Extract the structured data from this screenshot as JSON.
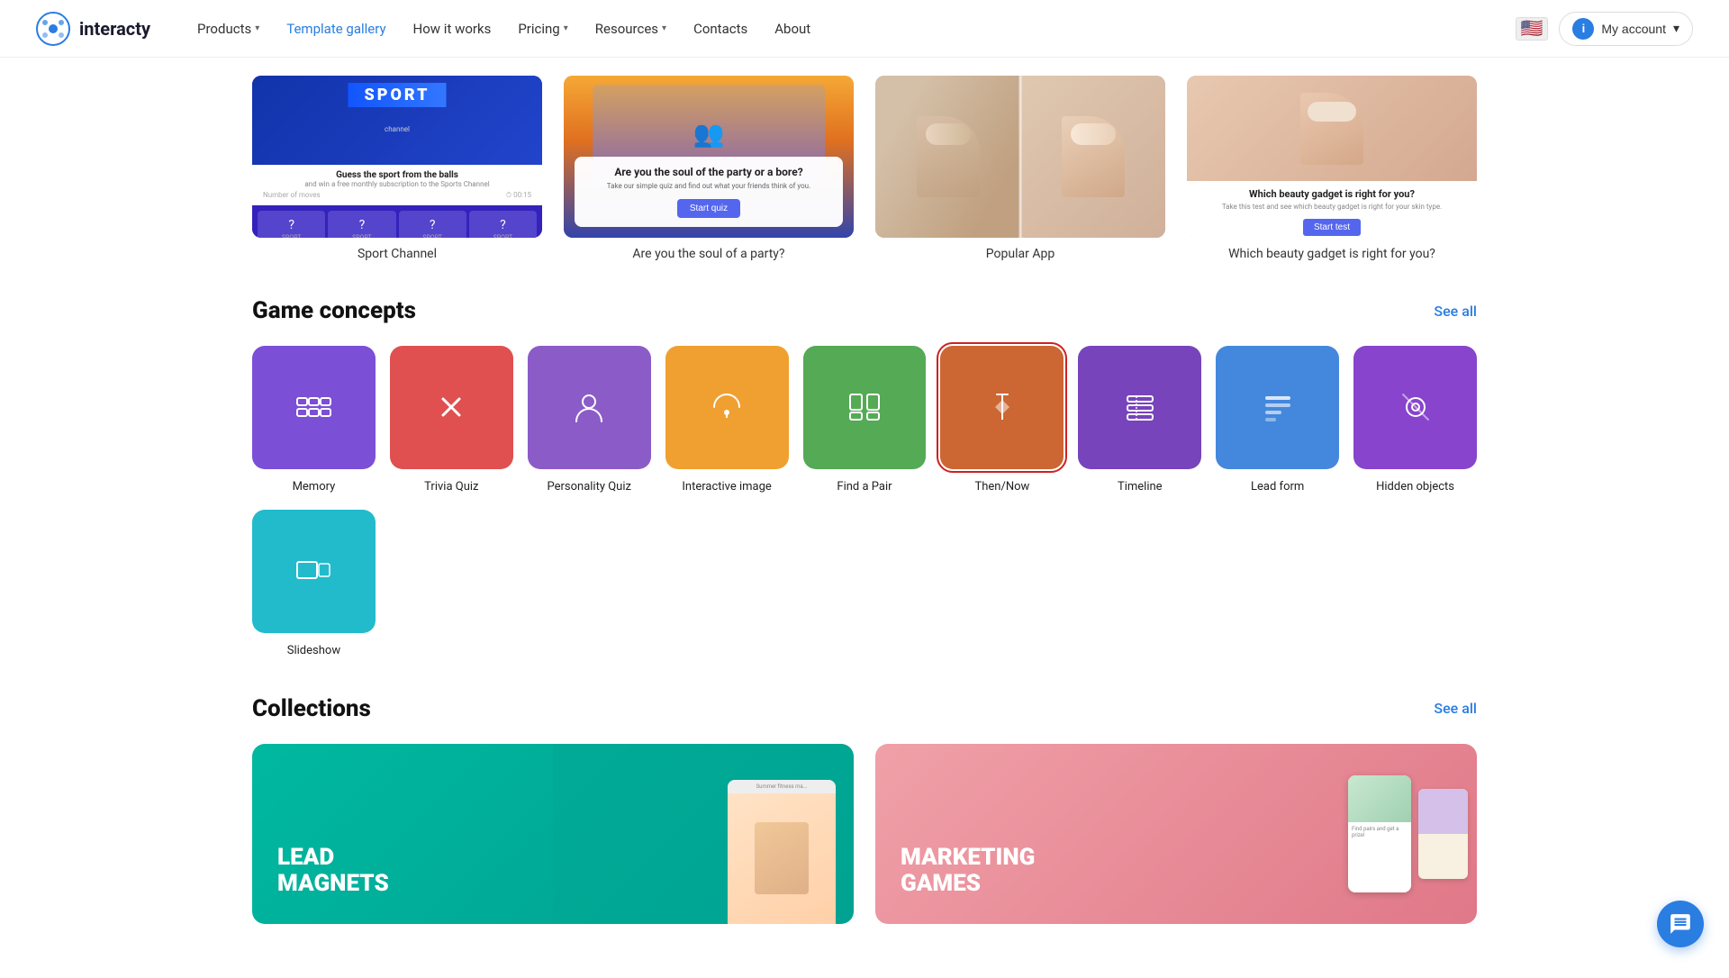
{
  "brand": {
    "name": "interacty"
  },
  "nav": {
    "links": [
      {
        "label": "Products",
        "hasDropdown": true,
        "active": false
      },
      {
        "label": "Template gallery",
        "hasDropdown": false,
        "active": true
      },
      {
        "label": "How it works",
        "hasDropdown": false,
        "active": false
      },
      {
        "label": "Pricing",
        "hasDropdown": true,
        "active": false
      },
      {
        "label": "Resources",
        "hasDropdown": true,
        "active": false
      },
      {
        "label": "Contacts",
        "hasDropdown": false,
        "active": false
      },
      {
        "label": "About",
        "hasDropdown": false,
        "active": false
      }
    ],
    "account_label": "My account",
    "flag": "🇺🇸"
  },
  "featured_templates": [
    {
      "title": "Sport Channel",
      "type": "sport"
    },
    {
      "title": "Are you the soul of a party?",
      "type": "party"
    },
    {
      "title": "Popular App",
      "type": "popular"
    },
    {
      "title": "Which beauty gadget is right for you?",
      "type": "beauty"
    }
  ],
  "game_concepts": {
    "section_title": "Game concepts",
    "see_all": "See all",
    "items": [
      {
        "label": "Memory",
        "color": "#7B4FD6",
        "type": "memory",
        "selected": false
      },
      {
        "label": "Trivia Quiz",
        "color": "#E05050",
        "type": "trivia",
        "selected": false
      },
      {
        "label": "Personality Quiz",
        "color": "#8B5CC8",
        "type": "personality",
        "selected": false
      },
      {
        "label": "Interactive image",
        "color": "#F0A030",
        "type": "interactive",
        "selected": false
      },
      {
        "label": "Find a Pair",
        "color": "#55AA55",
        "type": "findpair",
        "selected": false
      },
      {
        "label": "Then/Now",
        "color": "#CC6633",
        "type": "thennow",
        "selected": true
      },
      {
        "label": "Timeline",
        "color": "#7744BB",
        "type": "timeline",
        "selected": false
      },
      {
        "label": "Lead form",
        "color": "#4488DD",
        "type": "leadform",
        "selected": false
      },
      {
        "label": "Hidden objects",
        "color": "#8844CC",
        "type": "hidden",
        "selected": false
      },
      {
        "label": "Slideshow",
        "color": "#22BBCC",
        "type": "slideshow",
        "selected": false
      }
    ]
  },
  "collections": {
    "section_title": "Collections",
    "see_all": "See all",
    "items": [
      {
        "label": "LEAD\nMAGNETS",
        "type": "lead"
      },
      {
        "label": "MARKETING\nGAMES",
        "type": "marketing"
      }
    ]
  }
}
